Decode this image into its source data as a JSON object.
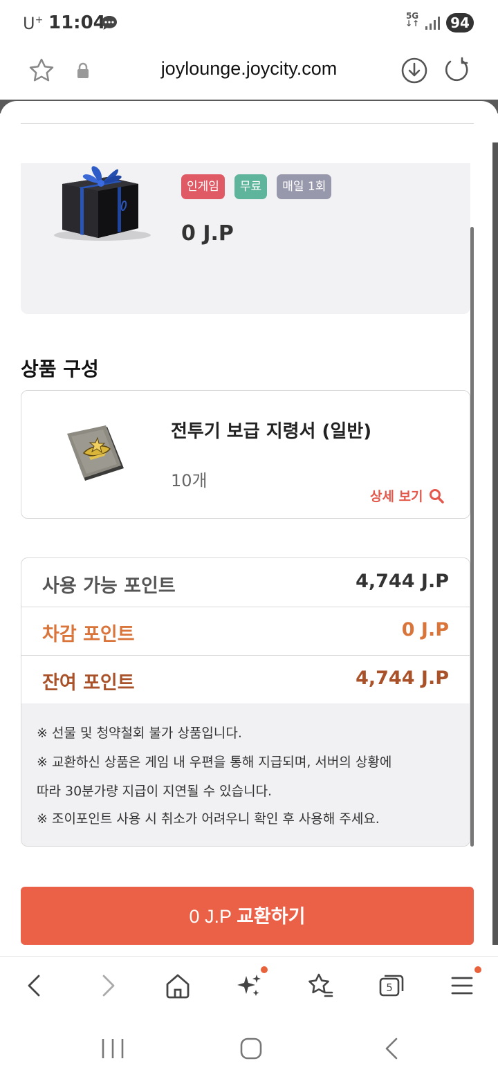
{
  "status_bar": {
    "carrier": "U",
    "carrier_sup": "+",
    "time": "11:04",
    "network": "5G",
    "battery": "94"
  },
  "url_bar": {
    "url": "joylounge.joycity.com"
  },
  "product": {
    "tags": [
      "인게임",
      "무료",
      "매일 1회"
    ],
    "price": "0 J.P"
  },
  "composition": {
    "title": "상품 구성",
    "item_name": "전투기 보급 지령서 (일반)",
    "item_qty": "10개",
    "detail_label": "상세 보기"
  },
  "points": {
    "available_label": "사용 가능 포인트",
    "available_value": "4,744 J.P",
    "deduct_label": "차감 포인트",
    "deduct_value": "0 J.P",
    "remain_label": "잔여 포인트",
    "remain_value": "4,744 J.P"
  },
  "notices": [
    "※ 선물 및 청약철회 불가 상품입니다.",
    "※ 교환하신 상품은 게임 내 우편을 통해 지급되며, 서버의 상황에",
    "따라 30분가량 지급이 지연될 수 있습니다.",
    "※ 조이포인트 사용 시 취소가 어려우니 확인 후 사용해 주세요."
  ],
  "exchange": {
    "amount": "0 J.P",
    "action": "교환하기"
  },
  "browser_nav": {
    "tabs_count": "5"
  },
  "colors": {
    "accent": "#eb6147",
    "tag_ingame": "#df5a64",
    "tag_free": "#5fb59b",
    "tag_daily": "#9898ad"
  }
}
